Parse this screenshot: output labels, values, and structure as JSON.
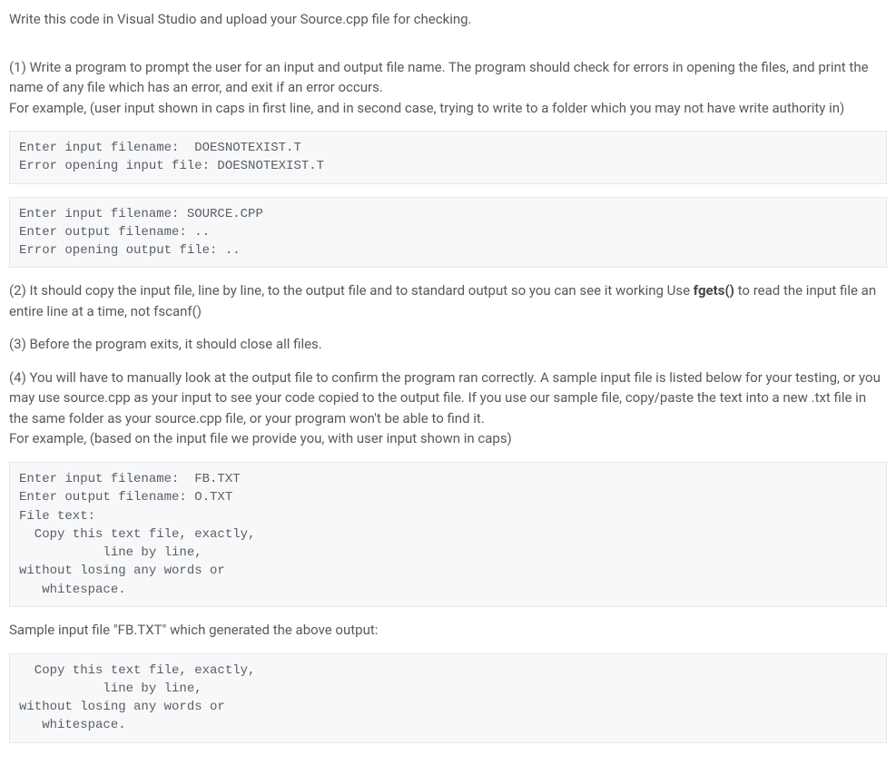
{
  "intro": "Write this code in Visual Studio and upload your Source.cpp file for checking.",
  "part1": {
    "text_a": "(1) Write a program to prompt the user for an input and output file name. The program should check for errors in opening the files, and print the name of any file which has an error, and exit if an error occurs.",
    "text_b": "For example, (user input shown in caps in first line, and in second case, trying to write to a folder which you may not have write authority in)"
  },
  "code1": "Enter input filename:  DOESNOTEXIST.T\nError opening input file: DOESNOTEXIST.T",
  "code2": "Enter input filename: SOURCE.CPP\nEnter output filename: ..\nError opening output file: ..",
  "part2": {
    "prefix": "(2) It should copy the input file, line by line, to the output file and to standard output so you can see it working Use ",
    "bold": "fgets()",
    "suffix": " to read the input file an entire line at a time, not fscanf()"
  },
  "part3": "(3) Before the program exits, it should close all files.",
  "part4": {
    "text_a": "(4) You will have to manually look at the output file to confirm the program ran correctly. A sample input file is listed below for your testing, or you may use source.cpp as your input to see your code copied to the output file. If you use our sample file, copy/paste the text into a new .txt file in the same folder as your source.cpp file, or your program won't be able to find it.",
    "text_b": "For example, (based on the input file we provide you, with user input shown in caps)"
  },
  "code3": "Enter input filename:  FB.TXT\nEnter output filename: O.TXT\nFile text:\n  Copy this text file, exactly,\n           line by line,\nwithout losing any words or\n   whitespace.",
  "sample_label": "Sample input file \"FB.TXT\" which generated the above output:",
  "code4": "  Copy this text file, exactly,\n           line by line,\nwithout losing any words or\n   whitespace."
}
